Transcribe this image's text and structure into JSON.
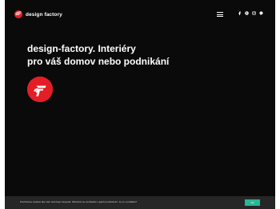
{
  "header": {
    "brand_name": "design factory",
    "menu_icon": "hamburger-icon",
    "social_icons": [
      "facebook-icon",
      "pinterest-icon",
      "instagram-icon",
      "messenger-icon"
    ]
  },
  "hero": {
    "title_line1": "design-factory. Interiéry",
    "title_line2": "pro váš domov nebo podnikání",
    "logo_icon": "design-factory-logo"
  },
  "cookie_bar": {
    "text": "Používáme cookies aby vám web lépe fungoval. Kliknutím se souhlasíte s jejich používáním. Je to v pořádku?",
    "button_label": "Ok"
  },
  "colors": {
    "background": "#0a0a0a",
    "brand_red": "#e41e26",
    "cookie_bar": "#262626",
    "accept_button": "#2bb596"
  }
}
